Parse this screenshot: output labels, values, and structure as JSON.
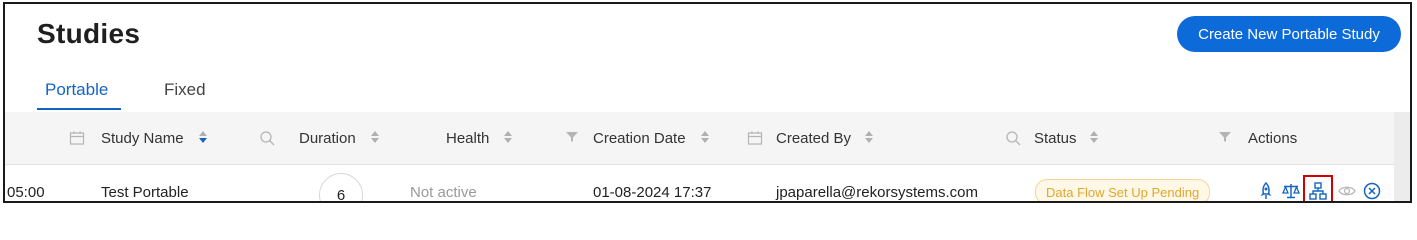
{
  "page": {
    "title": "Studies",
    "create_button": "Create New Portable Study"
  },
  "tabs": [
    {
      "label": "Portable",
      "active": true
    },
    {
      "label": "Fixed",
      "active": false
    }
  ],
  "table": {
    "headers": {
      "study_name": "Study Name",
      "duration": "Duration",
      "health": "Health",
      "creation_date": "Creation Date",
      "created_by": "Created By",
      "status": "Status",
      "actions": "Actions"
    },
    "rows": [
      {
        "time": "05:00",
        "study_name": "Test Portable",
        "duration": "6",
        "health": "Not active",
        "creation_date": "01-08-2024 17:37",
        "created_by": "jpaparella@rekorsystems.com",
        "status": "Data Flow Set Up Pending"
      }
    ]
  },
  "actions": [
    "rocket-icon",
    "scale-icon",
    "hierarchy-icon",
    "eye-icon",
    "close-circle-icon"
  ],
  "colors": {
    "accent": "#0d6ad9",
    "status_pending_text": "#e0a631",
    "status_pending_bg": "#fff8e6",
    "highlight": "#d10000"
  }
}
